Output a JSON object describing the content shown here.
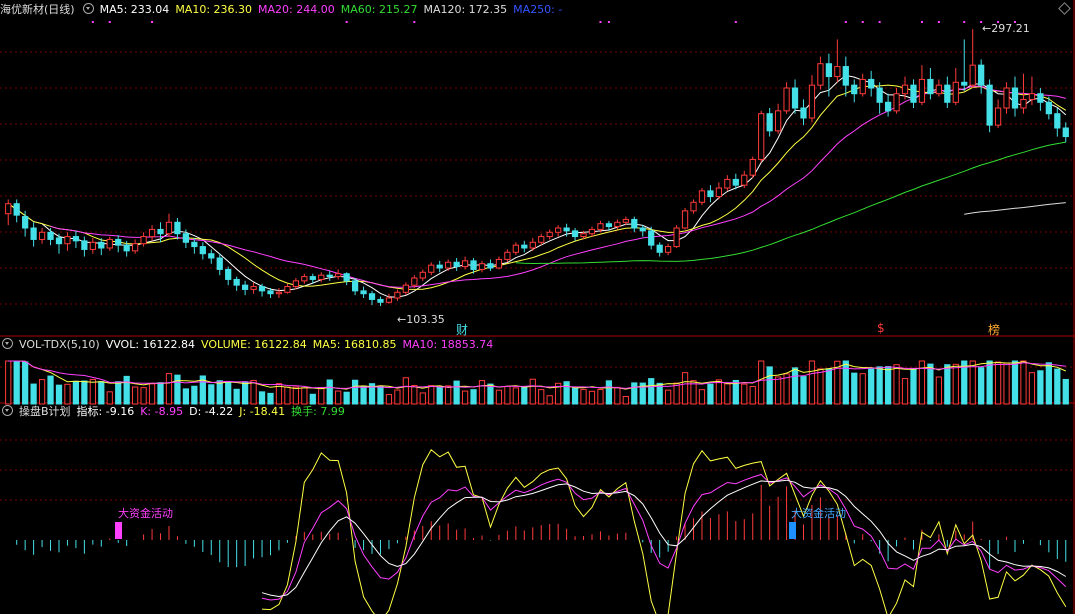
{
  "colors": {
    "up": "#ff3b3b",
    "down": "#44e0e8",
    "ma5": "#ffffff",
    "ma10": "#ffff44",
    "ma20": "#ff40ff",
    "ma60": "#33dd33",
    "ma120": "#dddddd",
    "ma250": "#3355ff",
    "grid": "#7a0000",
    "border": "#b00000"
  },
  "main_header": {
    "title": "海优新材(日线)",
    "ma5": "MA5: 233.04",
    "ma10": "MA10: 236.30",
    "ma20": "MA20: 244.00",
    "ma60": "MA60: 215.27",
    "ma120": "MA120: 172.35",
    "ma250": "MA250: -"
  },
  "volume_header": {
    "indicator": "VOL-TDX(5,10)",
    "vvol": "VVOL: 16122.84",
    "volume": "VOLUME: 16122.84",
    "ma5": "MA5: 16810.85",
    "ma10": "MA10: 18853.74"
  },
  "kdj_header": {
    "indicator": "操盘B计划",
    "zhibiao": "指标: -9.16",
    "k": "K: -8.95",
    "d": "D: -4.22",
    "j": "J: -18.41",
    "huanshou": "换手: 7.99"
  },
  "annotations": {
    "high_label": "297.21",
    "low_label": "103.35",
    "cai_marker": "财",
    "dollar_marker": "$",
    "bang_marker": "榜",
    "big_fund_1": "大资金活动",
    "big_fund_2": "大资金活动"
  },
  "chart_data": [
    {
      "type": "candlestick",
      "title": "海优新材(日线)",
      "ylim": [
        95,
        305
      ],
      "high": 297.21,
      "low": 103.35,
      "series": [
        {
          "name": "MA5",
          "last": 233.04
        },
        {
          "name": "MA10",
          "last": 236.3
        },
        {
          "name": "MA20",
          "last": 244.0
        },
        {
          "name": "MA60",
          "last": 215.27
        },
        {
          "name": "MA120",
          "last": 172.35
        },
        {
          "name": "MA250"
        }
      ],
      "candles": [
        [
          168,
          175,
          160,
          178
        ],
        [
          175,
          167,
          162,
          178
        ],
        [
          166,
          158,
          152,
          170
        ],
        [
          158,
          150,
          145,
          162
        ],
        [
          150,
          155,
          147,
          158
        ],
        [
          155,
          150,
          146,
          158
        ],
        [
          151,
          147,
          140,
          154
        ],
        [
          147,
          152,
          142,
          155
        ],
        [
          152,
          149,
          144,
          156
        ],
        [
          149,
          143,
          138,
          152
        ],
        [
          143,
          148,
          140,
          151
        ],
        [
          148,
          144,
          139,
          151
        ],
        [
          144,
          150,
          142,
          152
        ],
        [
          150,
          146,
          141,
          153
        ],
        [
          146,
          142,
          138,
          149
        ],
        [
          142,
          147,
          140,
          150
        ],
        [
          147,
          152,
          145,
          155
        ],
        [
          152,
          157,
          149,
          160
        ],
        [
          157,
          154,
          148,
          162
        ],
        [
          154,
          162,
          152,
          168
        ],
        [
          162,
          154,
          150,
          165
        ],
        [
          154,
          148,
          144,
          157
        ],
        [
          148,
          145,
          140,
          151
        ],
        [
          145,
          140,
          136,
          148
        ],
        [
          140,
          137,
          133,
          143
        ],
        [
          137,
          129,
          125,
          140
        ],
        [
          129,
          122,
          118,
          131
        ],
        [
          122,
          118,
          114,
          124
        ],
        [
          118,
          115,
          111,
          121
        ],
        [
          115,
          117,
          112,
          120
        ],
        [
          117,
          114,
          110,
          119
        ],
        [
          114,
          112,
          109,
          116
        ],
        [
          112,
          113,
          109,
          116
        ],
        [
          113,
          117,
          112,
          119
        ],
        [
          117,
          121,
          115,
          123
        ],
        [
          121,
          124,
          119,
          126
        ],
        [
          124,
          122,
          119,
          126
        ],
        [
          122,
          125,
          120,
          127
        ],
        [
          125,
          124,
          121,
          128
        ],
        [
          124,
          126,
          122,
          129
        ],
        [
          126,
          121,
          118,
          127
        ],
        [
          121,
          114,
          111,
          123
        ],
        [
          114,
          112,
          109,
          117
        ],
        [
          112,
          108,
          104,
          114
        ],
        [
          108,
          106,
          103.35,
          110
        ],
        [
          106,
          109,
          105,
          112
        ],
        [
          109,
          113,
          107,
          115
        ],
        [
          113,
          118,
          111,
          120
        ],
        [
          118,
          123,
          116,
          125
        ],
        [
          123,
          127,
          121,
          129
        ],
        [
          127,
          132,
          125,
          134
        ],
        [
          132,
          130,
          127,
          135
        ],
        [
          130,
          134,
          128,
          136
        ],
        [
          134,
          131,
          128,
          137
        ],
        [
          131,
          135,
          129,
          138
        ],
        [
          135,
          129,
          126,
          137
        ],
        [
          129,
          133,
          127,
          135
        ],
        [
          133,
          130,
          128,
          136
        ],
        [
          130,
          136,
          129,
          138
        ],
        [
          136,
          141,
          134,
          143
        ],
        [
          141,
          146,
          139,
          148
        ],
        [
          146,
          144,
          141,
          149
        ],
        [
          144,
          148,
          142,
          151
        ],
        [
          148,
          152,
          146,
          154
        ],
        [
          152,
          155,
          150,
          157
        ],
        [
          155,
          158,
          152,
          160
        ],
        [
          158,
          156,
          152,
          161
        ],
        [
          156,
          152,
          149,
          158
        ],
        [
          152,
          154,
          150,
          156
        ],
        [
          154,
          157,
          152,
          159
        ],
        [
          157,
          161,
          155,
          163
        ],
        [
          161,
          159,
          156,
          163
        ],
        [
          159,
          162,
          157,
          164
        ],
        [
          162,
          164,
          160,
          166
        ],
        [
          164,
          158,
          155,
          166
        ],
        [
          158,
          156,
          152,
          160
        ],
        [
          156,
          146,
          143,
          159
        ],
        [
          146,
          141,
          138,
          148
        ],
        [
          141,
          145,
          139,
          147
        ],
        [
          145,
          158,
          144,
          160
        ],
        [
          158,
          170,
          157,
          172
        ],
        [
          170,
          176,
          168,
          178
        ],
        [
          176,
          184,
          174,
          186
        ],
        [
          184,
          180,
          176,
          188
        ],
        [
          180,
          186,
          178,
          190
        ],
        [
          186,
          192,
          184,
          195
        ],
        [
          192,
          188,
          185,
          196
        ],
        [
          188,
          195,
          186,
          198
        ],
        [
          195,
          206,
          193,
          208
        ],
        [
          206,
          238,
          204,
          240
        ],
        [
          238,
          226,
          222,
          242
        ],
        [
          226,
          240,
          224,
          245
        ],
        [
          240,
          256,
          238,
          260
        ],
        [
          256,
          242,
          238,
          262
        ],
        [
          242,
          235,
          230,
          248
        ],
        [
          235,
          258,
          232,
          265
        ],
        [
          258,
          273,
          255,
          278
        ],
        [
          273,
          264,
          250,
          280
        ],
        [
          264,
          271,
          260,
          290
        ],
        [
          271,
          258,
          250,
          278
        ],
        [
          258,
          252,
          246,
          262
        ],
        [
          252,
          262,
          250,
          266
        ],
        [
          262,
          256,
          250,
          268
        ],
        [
          256,
          246,
          238,
          260
        ],
        [
          246,
          240,
          236,
          252
        ],
        [
          240,
          252,
          238,
          256
        ],
        [
          252,
          258,
          248,
          264
        ],
        [
          258,
          246,
          242,
          262
        ],
        [
          246,
          262,
          244,
          272
        ],
        [
          262,
          252,
          248,
          270
        ],
        [
          252,
          258,
          250,
          262
        ],
        [
          258,
          246,
          242,
          264
        ],
        [
          246,
          260,
          244,
          270
        ],
        [
          260,
          258,
          254,
          290
        ],
        [
          258,
          272,
          256,
          297.21
        ],
        [
          272,
          258,
          252,
          276
        ],
        [
          258,
          230,
          225,
          262
        ],
        [
          230,
          242,
          228,
          248
        ],
        [
          242,
          256,
          238,
          260
        ],
        [
          256,
          242,
          236,
          264
        ],
        [
          242,
          248,
          238,
          266
        ],
        [
          248,
          252,
          244,
          264
        ],
        [
          252,
          246,
          240,
          256
        ],
        [
          246,
          238,
          234,
          250
        ],
        [
          238,
          228,
          222,
          242
        ],
        [
          228,
          222,
          218,
          232
        ]
      ]
    },
    {
      "type": "bar",
      "title": "VOL-TDX(5,10)",
      "series": [
        {
          "name": "VVOL",
          "last": 16122.84
        },
        {
          "name": "VOLUME",
          "last": 16122.84
        },
        {
          "name": "MA5",
          "last": 16810.85
        },
        {
          "name": "MA10",
          "last": 18853.74
        }
      ]
    },
    {
      "type": "line",
      "title": "操盘B计划",
      "series": [
        {
          "name": "指标",
          "last": -9.16
        },
        {
          "name": "K",
          "last": -8.95
        },
        {
          "name": "D",
          "last": -4.22
        },
        {
          "name": "J",
          "last": -18.41
        },
        {
          "name": "换手",
          "last": 7.99
        }
      ]
    }
  ]
}
